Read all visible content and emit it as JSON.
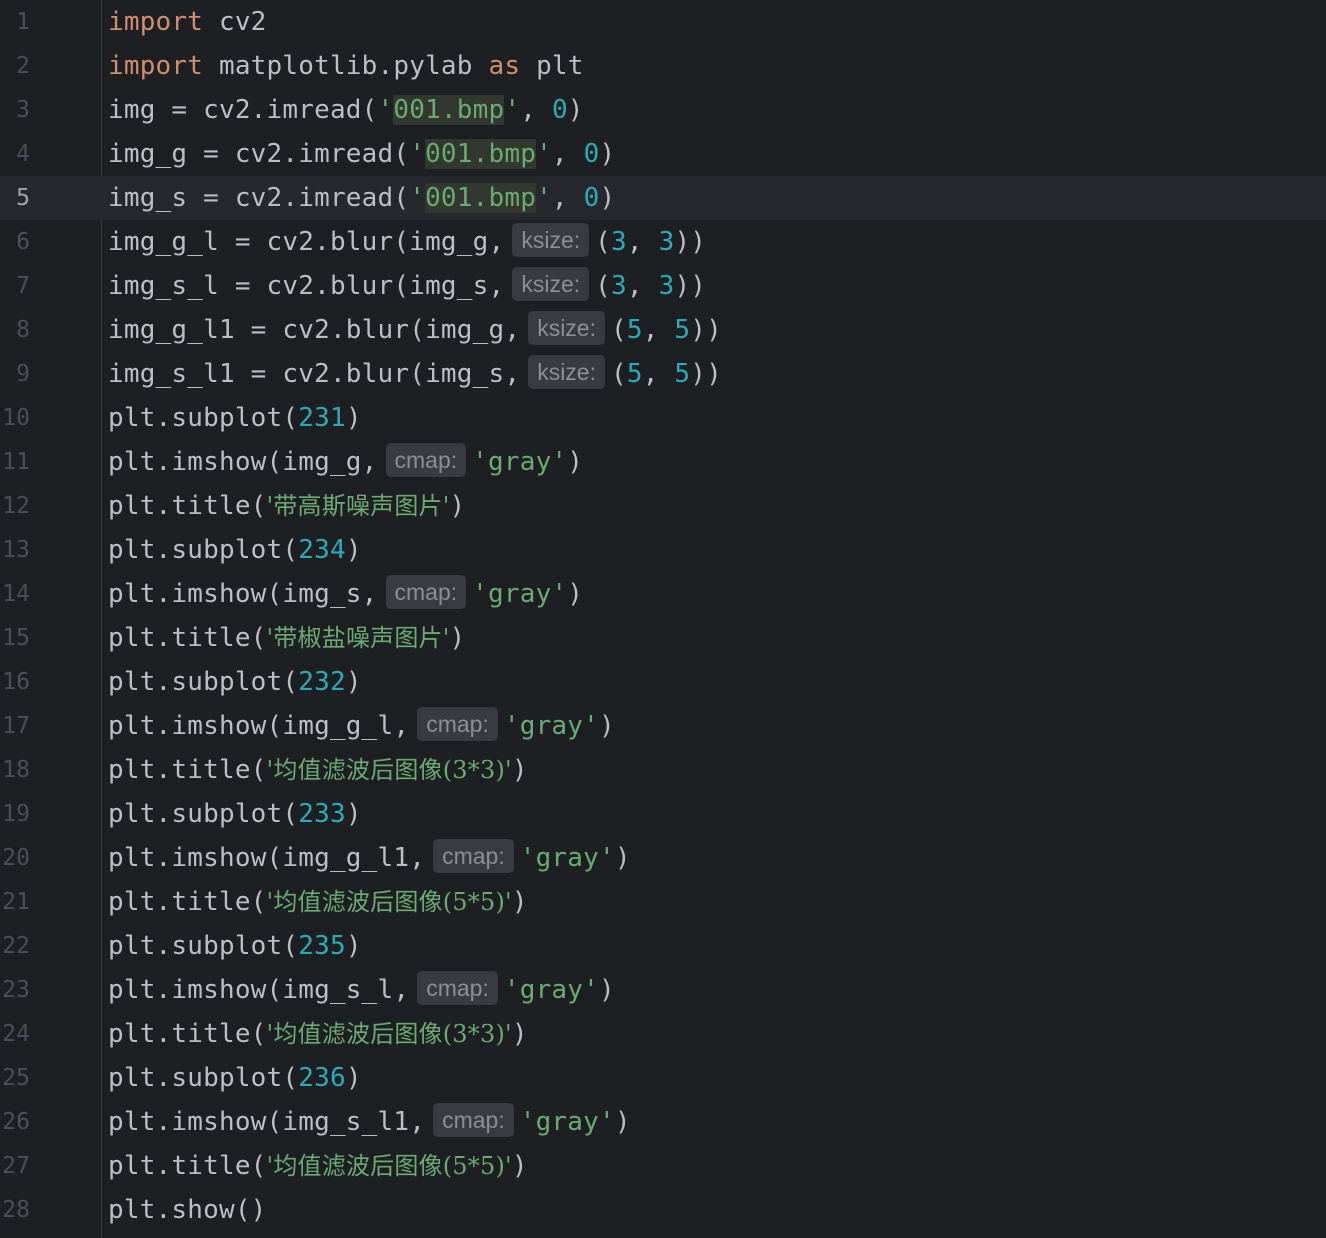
{
  "editor": {
    "current_line": 5,
    "lines": [
      {
        "n": "1"
      },
      {
        "n": "2"
      },
      {
        "n": "3"
      },
      {
        "n": "4"
      },
      {
        "n": "5"
      },
      {
        "n": "6"
      },
      {
        "n": "7"
      },
      {
        "n": "8"
      },
      {
        "n": "9"
      },
      {
        "n": "10"
      },
      {
        "n": "11"
      },
      {
        "n": "12"
      },
      {
        "n": "13"
      },
      {
        "n": "14"
      },
      {
        "n": "15"
      },
      {
        "n": "16"
      },
      {
        "n": "17"
      },
      {
        "n": "18"
      },
      {
        "n": "19"
      },
      {
        "n": "20"
      },
      {
        "n": "21"
      },
      {
        "n": "22"
      },
      {
        "n": "23"
      },
      {
        "n": "24"
      },
      {
        "n": "25"
      },
      {
        "n": "26"
      },
      {
        "n": "27"
      },
      {
        "n": "28"
      }
    ],
    "tokens": {
      "import": "import",
      "as": "as",
      "cv2": " cv2",
      "l2_mid": " matplotlib.pylab ",
      "l2_end": " plt",
      "imread_img": "img = cv2.imread(",
      "imread_img_g": "img_g = cv2.imread(",
      "imread_img_s": "img_s = cv2.imread(",
      "quote": "'",
      "file": "001.bmp",
      "comma_sp": ", ",
      "zero": "0",
      "rparen": ")",
      "rparen2": "))",
      "blur_gl": "img_g_l = cv2.blur(img_g,",
      "blur_sl": "img_s_l = cv2.blur(img_s,",
      "blur_gl1": "img_g_l1 = cv2.blur(img_g,",
      "blur_sl1": "img_s_l1 = cv2.blur(img_s,",
      "ksize": "ksize:",
      "lparen": "(",
      "three": "3",
      "five": "5",
      "subplot": "plt.subplot(",
      "sp231": "231",
      "sp234": "234",
      "sp232": "232",
      "sp233": "233",
      "sp235": "235",
      "sp236": "236",
      "imshow_g": "plt.imshow(img_g,",
      "imshow_s": "plt.imshow(img_s,",
      "imshow_gl": "plt.imshow(img_g_l,",
      "imshow_gl1": "plt.imshow(img_g_l1,",
      "imshow_sl": "plt.imshow(img_s_l,",
      "imshow_sl1": "plt.imshow(img_s_l1,",
      "cmap": "cmap:",
      "gray": "'gray'",
      "title": "plt.title(",
      "t_gauss": "'带高斯噪声图片'",
      "t_salt": "'带椒盐噪声图片'",
      "t_mean3": "'均值滤波后图像(3*3)'",
      "t_mean5": "'均值滤波后图像(5*5)'",
      "show": "plt.show()"
    }
  }
}
